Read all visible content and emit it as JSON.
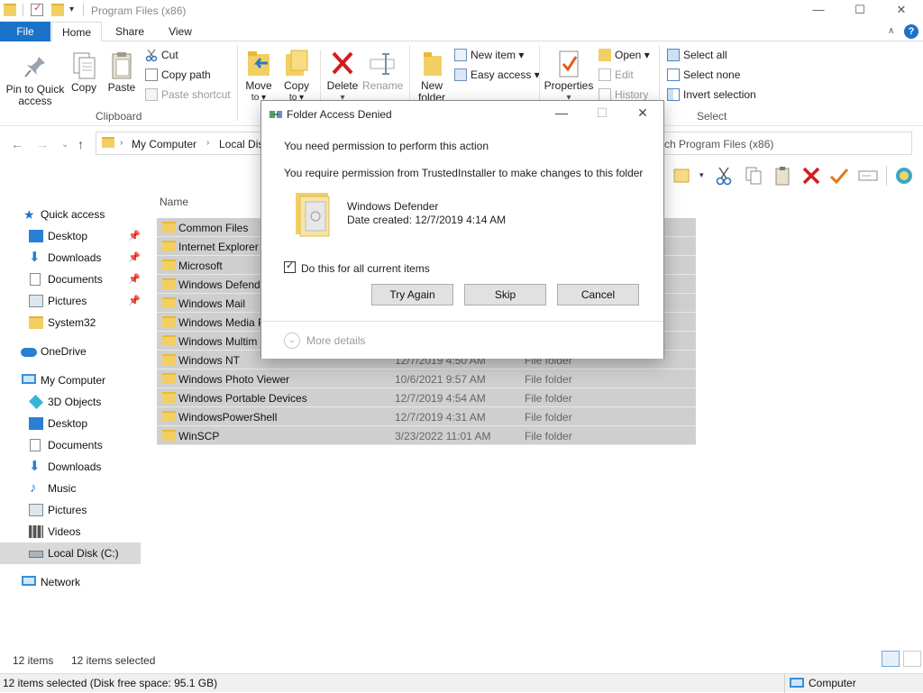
{
  "window": {
    "title": "Program Files (x86)",
    "controls": {
      "minimize": "—",
      "maximize": "☐",
      "close": "✕"
    }
  },
  "ribbon_tabs": {
    "file": "File",
    "home": "Home",
    "share": "Share",
    "view": "View",
    "help": "?"
  },
  "ribbon": {
    "clipboard": {
      "pin_line1": "Pin to Quick",
      "pin_line2": "access",
      "copy": "Copy",
      "paste": "Paste",
      "cut": "Cut",
      "copy_path": "Copy path",
      "paste_shortcut": "Paste shortcut",
      "label": "Clipboard"
    },
    "organize": {
      "move_to": "Move",
      "move_to_2": "to ▾",
      "copy_to": "Copy",
      "copy_to_2": "to ▾",
      "delete": "Delete",
      "delete_2": "▾",
      "rename": "Rename"
    },
    "new": {
      "new_folder": "New",
      "new_folder_2": "folder",
      "new_item": "New item ▾",
      "easy_access": "Easy access ▾"
    },
    "open": {
      "properties": "Properties",
      "properties_2": "▾",
      "open": "Open ▾",
      "edit": "Edit",
      "history": "History"
    },
    "select": {
      "select_all": "Select all",
      "select_none": "Select none",
      "invert": "Invert selection",
      "label": "Select"
    }
  },
  "address": {
    "segments": [
      "My Computer",
      "Local Disk"
    ],
    "search_placeholder": "ch Program Files (x86)"
  },
  "nav": {
    "quick_access": "Quick access",
    "desktop": "Desktop",
    "downloads": "Downloads",
    "documents": "Documents",
    "pictures": "Pictures",
    "system32": "System32",
    "onedrive": "OneDrive",
    "my_computer": "My Computer",
    "objects3d": "3D Objects",
    "desktop2": "Desktop",
    "documents2": "Documents",
    "downloads2": "Downloads",
    "music": "Music",
    "pictures2": "Pictures",
    "videos": "Videos",
    "local_disk": "Local Disk (C:)",
    "network": "Network"
  },
  "files": {
    "col_name": "Name",
    "rows": [
      {
        "name": "Common Files",
        "date": "",
        "type": ""
      },
      {
        "name": "Internet Explorer",
        "date": "",
        "type": ""
      },
      {
        "name": "Microsoft",
        "date": "",
        "type": ""
      },
      {
        "name": "Windows Defend",
        "date": "",
        "type": ""
      },
      {
        "name": "Windows Mail",
        "date": "",
        "type": ""
      },
      {
        "name": "Windows Media P",
        "date": "",
        "type": ""
      },
      {
        "name": "Windows Multim",
        "date": "",
        "type": ""
      },
      {
        "name": "Windows NT",
        "date": "12/7/2019 4:50 AM",
        "type": "File folder"
      },
      {
        "name": "Windows Photo Viewer",
        "date": "10/6/2021 9:57 AM",
        "type": "File folder"
      },
      {
        "name": "Windows Portable Devices",
        "date": "12/7/2019 4:54 AM",
        "type": "File folder"
      },
      {
        "name": "WindowsPowerShell",
        "date": "12/7/2019 4:31 AM",
        "type": "File folder"
      },
      {
        "name": "WinSCP",
        "date": "3/23/2022 11:01 AM",
        "type": "File folder"
      }
    ]
  },
  "status": {
    "items": "12 items",
    "selected": "12 items selected",
    "bar_left": "12 items selected (Disk free space: 95.1 GB)",
    "bar_right": "Computer"
  },
  "dialog": {
    "title": "Folder Access Denied",
    "line1": "You need permission to perform this action",
    "line2": "You require permission from TrustedInstaller to make changes to this folder",
    "item_name": "Windows Defender",
    "item_date": "Date created: 12/7/2019 4:14 AM",
    "checkbox_label": "Do this for all current items",
    "checkbox_checked": true,
    "try_again": "Try Again",
    "skip": "Skip",
    "cancel": "Cancel",
    "more_details": "More details",
    "controls": {
      "minimize": "—",
      "maximize": "☐",
      "close": "✕"
    }
  },
  "colors": {
    "accent": "#1a73c9",
    "selection": "#cfcfcf",
    "folder": "#f2cf63"
  }
}
